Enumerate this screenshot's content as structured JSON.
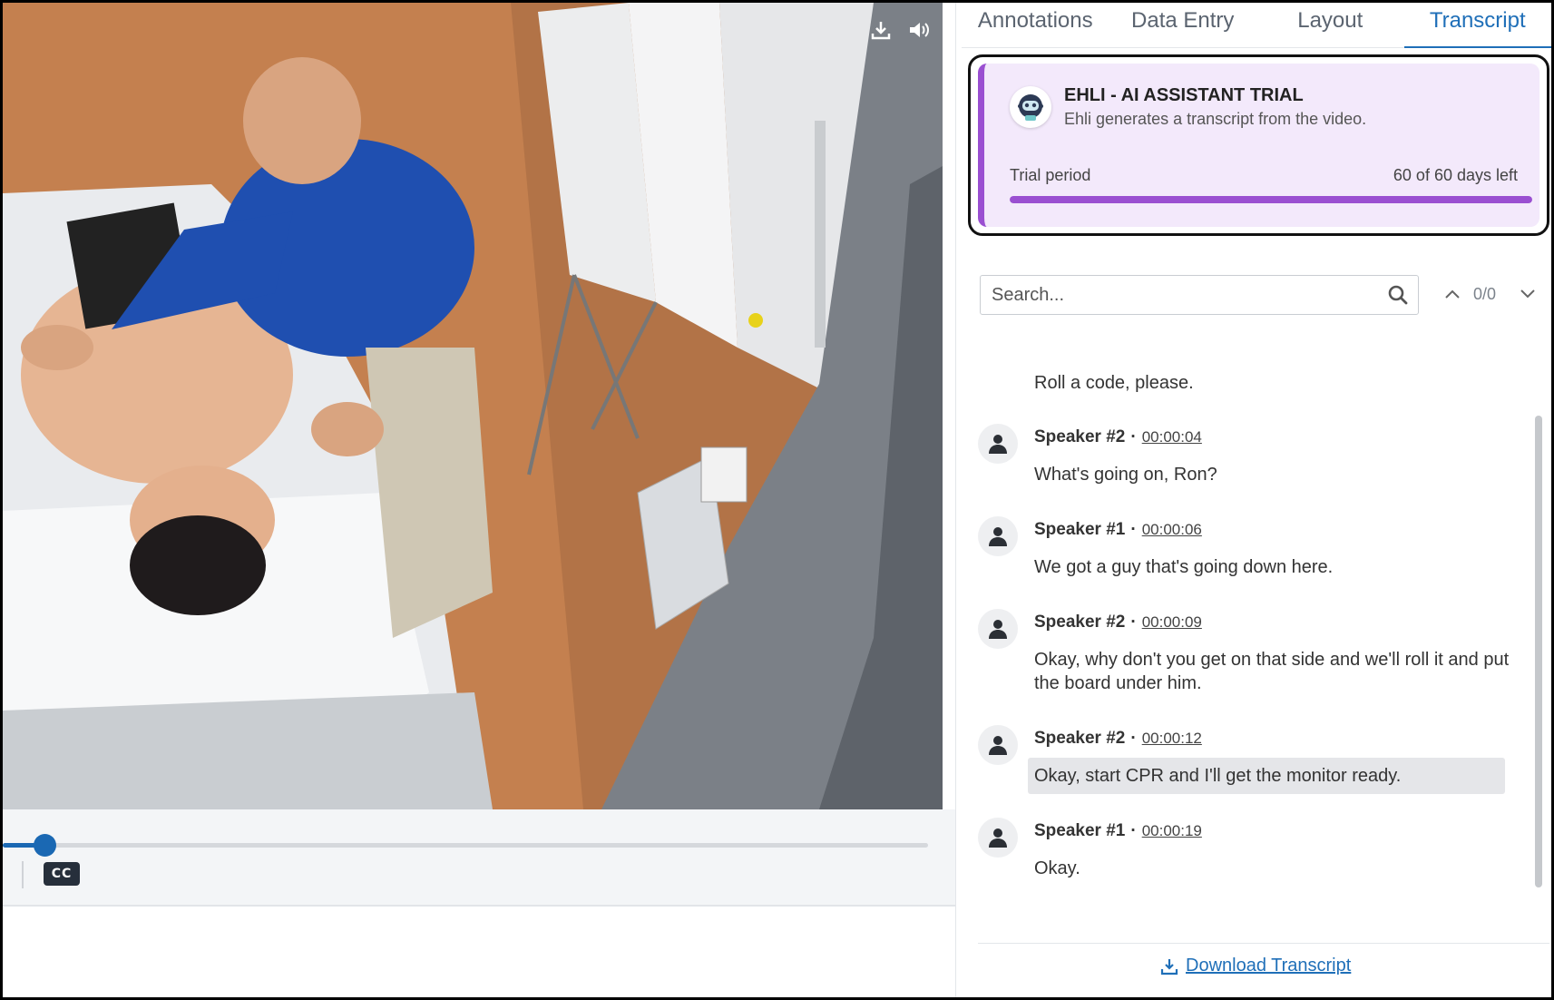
{
  "tabs": [
    {
      "label": "Annotations"
    },
    {
      "label": "Data Entry"
    },
    {
      "label": "Layout"
    },
    {
      "label": "Transcript"
    }
  ],
  "active_tab": "Transcript",
  "trial": {
    "title": "EHLI - AI ASSISTANT TRIAL",
    "subtitle": "Ehli generates a transcript from the video.",
    "period_label": "Trial period",
    "days_left": "60 of 60 days left",
    "progress": 1.0,
    "accent": "#9a4fd1"
  },
  "search": {
    "placeholder": "Search...",
    "counter": "0/0"
  },
  "video": {
    "progress": 0.045,
    "cc_label": "CC"
  },
  "transcript": [
    {
      "speaker": "",
      "timestamp": "",
      "text": "Roll a code, please."
    },
    {
      "speaker": "Speaker #2",
      "timestamp": "00:00:04",
      "text": "What's going on, Ron?"
    },
    {
      "speaker": "Speaker #1",
      "timestamp": "00:00:06",
      "text": "We got a guy that's going down here."
    },
    {
      "speaker": "Speaker #2",
      "timestamp": "00:00:09",
      "text": "Okay, why don't you get on that side and we'll roll it and put the board under him."
    },
    {
      "speaker": "Speaker #2",
      "timestamp": "00:00:12",
      "text": "Okay, start CPR and I'll get the monitor ready.",
      "highlighted": true
    },
    {
      "speaker": "Speaker #1",
      "timestamp": "00:00:19",
      "text": "Okay."
    }
  ],
  "download_label": "Download Transcript",
  "colors": {
    "link": "#1f6fb8",
    "player_accent": "#1a68b3"
  }
}
